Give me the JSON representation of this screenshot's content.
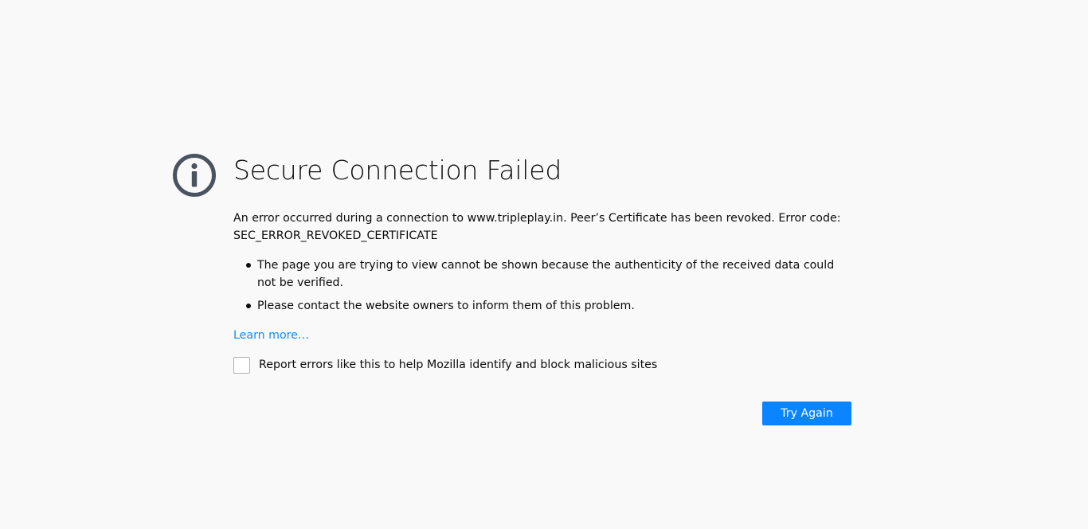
{
  "error_page": {
    "title": "Secure Connection Failed",
    "description": "An error occurred during a connection to www.tripleplay.in. Peer’s Certificate has been revoked. Error code:",
    "error_code": "SEC_ERROR_REVOKED_CERTIFICATE",
    "bullets": [
      "The page you are trying to view cannot be shown because the authenticity of the received data could not be verified.",
      "Please contact the website owners to inform them of this problem."
    ],
    "learn_more": "Learn more…",
    "report_label": "Report errors like this to help Mozilla identify and block malicious sites",
    "report_checked": false,
    "try_again_label": "Try Again"
  },
  "icons": {
    "header_icon": "info-icon"
  },
  "colors": {
    "background": "#f9f9fa",
    "text": "#0c0c0d",
    "icon": "#4a5460",
    "link": "#0a8dff",
    "primary_button": "#0a84ff"
  }
}
